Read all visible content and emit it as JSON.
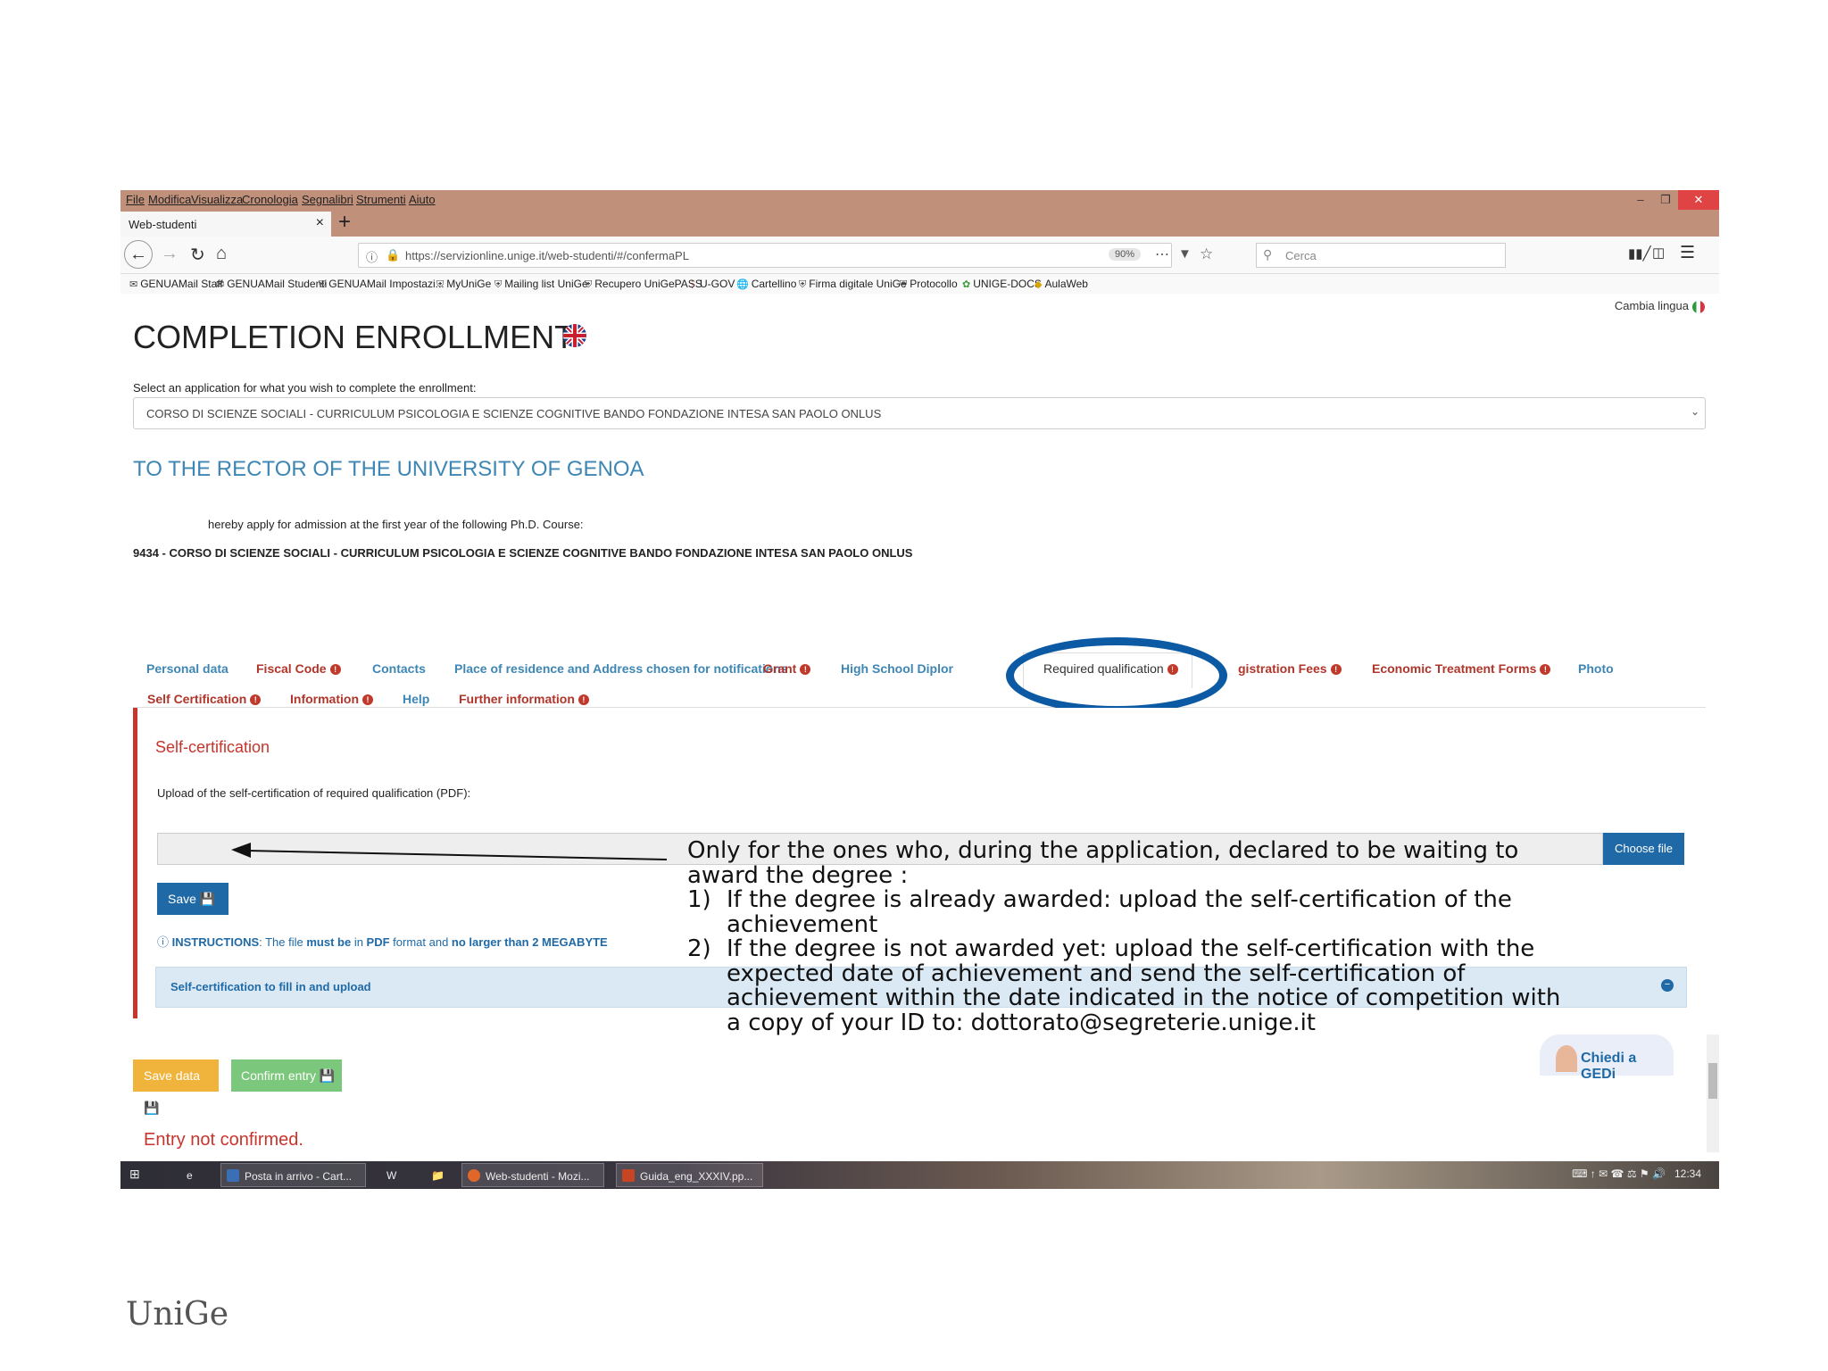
{
  "browser": {
    "menu": [
      "File",
      "Modifica",
      "Visualizza",
      "Cronologia",
      "Segnalibri",
      "Strumenti",
      "Aiuto"
    ],
    "tab_title": "Web-studenti",
    "url": "https://servizionline.unige.it/web-studenti/#/confermaPL",
    "zoom": "90%",
    "search_placeholder": "Cerca",
    "bookmarks": [
      "GENUAMail Staff",
      "GENUAMail Studenti",
      "GENUAMail Impostazi...",
      "MyUniGe",
      "Mailing list UniGe",
      "Recupero UniGePASS",
      "U-GOV",
      "Cartellino",
      "Firma digitale UniGe",
      "Protocollo",
      "UNIGE-DOCS",
      "AulaWeb"
    ]
  },
  "page": {
    "title": "COMPLETION ENROLLMENT",
    "lang_switch": "Cambia lingua",
    "select_label": "Select an application for what you wish to complete the enrollment:",
    "select_value": "CORSO DI SCIENZE SOCIALI - CURRICULUM PSICOLOGIA E SCIENZE COGNITIVE BANDO FONDAZIONE INTESA SAN PAOLO ONLUS",
    "rector_title": "TO THE RECTOR OF THE UNIVERSITY OF GENOA",
    "apply_text": "hereby apply for admission at the first year of the following Ph.D. Course:",
    "course_text": "9434 - CORSO DI SCIENZE SOCIALI - CURRICULUM PSICOLOGIA E SCIENZE COGNITIVE BANDO FONDAZIONE INTESA SAN PAOLO ONLUS",
    "tabs": [
      "Personal data",
      "Fiscal Code",
      "Contacts",
      "Place of residence and Address chosen for notifications",
      "Grant",
      "High School Diplor",
      "Required qualification",
      "gistration Fees",
      "Economic Treatment Forms",
      "Photo",
      "Self Certification",
      "Information",
      "Help",
      "Further information"
    ],
    "panel_title": "Self-certification",
    "upload_label": "Upload of the self-certification of required qualification (PDF):",
    "choose_file": "Choose file",
    "save": "Save",
    "instructions": {
      "label": "INSTRUCTIONS",
      "t1": ": The file ",
      "b1": "must be",
      "t2": " in ",
      "b2": "PDF",
      "t3": " format and ",
      "b3": "no larger than 2 MEGABYTE"
    },
    "accordion_label": "Self-certification to fill in and upload",
    "save_data": "Save data",
    "confirm_entry": "Confirm entry",
    "not_confirmed": "Entry not confirmed.",
    "chat": "Chiedi a GEDi"
  },
  "annotation": {
    "intro": "Only for the ones who, during the application, declared to be waiting to award the degree :",
    "items": [
      {
        "num": "1)",
        "text": "If the degree is already awarded: upload the self-certification of the achievement"
      },
      {
        "num": "2)",
        "text": "If the degree is not awarded yet: upload the self-certification with the expected date of achievement and send the self-certification of achievement within the date indicated in the notice of competition with a copy of your ID to: dottorato@segreterie.unige.it"
      }
    ]
  },
  "taskbar": {
    "items": [
      "Posta in arrivo - Cart...",
      "Web-studenti - Mozi...",
      "Guida_eng_XXXIV.pp..."
    ],
    "clock": "12:34"
  },
  "logo": "UniGe"
}
